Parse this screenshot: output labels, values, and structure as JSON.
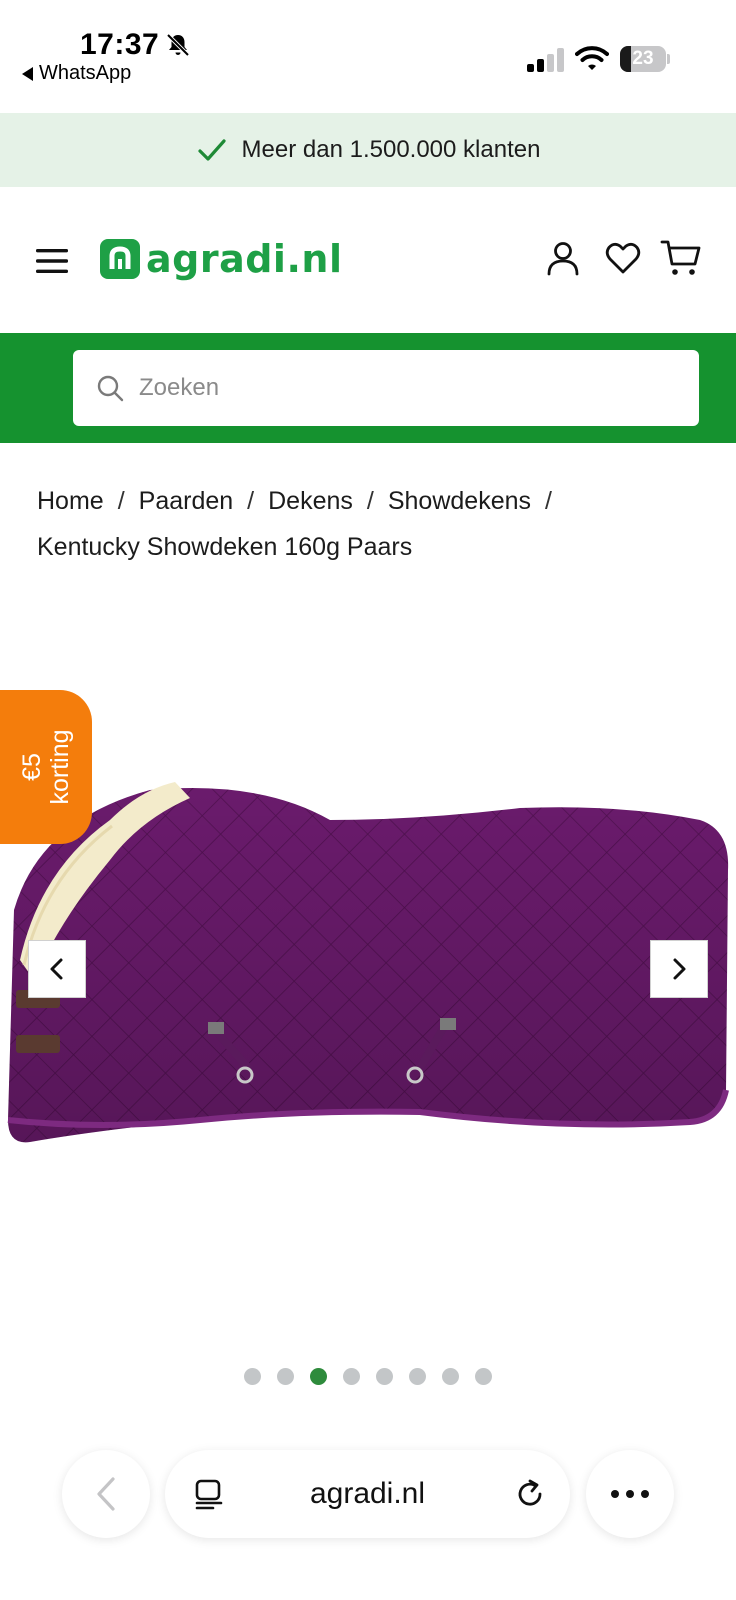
{
  "status_bar": {
    "time": "17:37",
    "back_app_label": "WhatsApp",
    "battery_level": "23",
    "battery_fraction": 0.23
  },
  "promo": {
    "text": "Meer dan 1.500.000 klanten",
    "icon": "check-icon"
  },
  "header": {
    "logo_text": "agradi.nl",
    "icons": [
      "menu-icon",
      "account-icon",
      "heart-icon",
      "cart-icon"
    ],
    "brand_color": "#1ea046"
  },
  "search": {
    "placeholder": "Zoeken",
    "band_color": "#15922f"
  },
  "breadcrumb": {
    "items": [
      "Home",
      "Paarden",
      "Dekens",
      "Showdekens",
      "Kentucky Showdeken 160g Paars"
    ],
    "separator": "/"
  },
  "gallery": {
    "discount_line1": "€5",
    "discount_line2": "korting",
    "discount_color": "#f47d0c",
    "slide_count": 8,
    "active_slide": 3,
    "product_color": "#6b1a6e"
  },
  "browser": {
    "url": "agradi.nl"
  }
}
